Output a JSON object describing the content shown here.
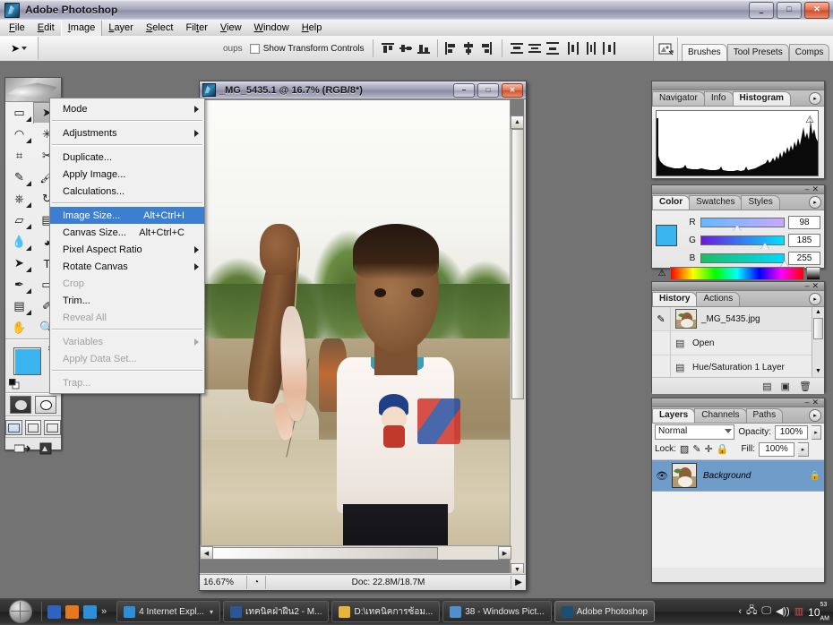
{
  "window": {
    "title": "Adobe Photoshop",
    "minimize": "–",
    "maximize": "□",
    "close": "✕"
  },
  "menubar": {
    "items": [
      {
        "label": "File",
        "accel": "F"
      },
      {
        "label": "Edit",
        "accel": "E"
      },
      {
        "label": "Image",
        "accel": "I"
      },
      {
        "label": "Layer",
        "accel": "L"
      },
      {
        "label": "Select",
        "accel": "S"
      },
      {
        "label": "Filter",
        "accel": "t"
      },
      {
        "label": "View",
        "accel": "V"
      },
      {
        "label": "Window",
        "accel": "W"
      },
      {
        "label": "Help",
        "accel": "H"
      }
    ],
    "active": "Image"
  },
  "image_menu": {
    "items": [
      {
        "label": "Mode",
        "shortcut": "",
        "submenu": true,
        "disabled": false,
        "selected": false
      },
      {
        "sep": true
      },
      {
        "label": "Adjustments",
        "shortcut": "",
        "submenu": true,
        "disabled": false,
        "selected": false
      },
      {
        "sep": true
      },
      {
        "label": "Duplicate...",
        "shortcut": "",
        "submenu": false,
        "disabled": false,
        "selected": false
      },
      {
        "label": "Apply Image...",
        "shortcut": "",
        "submenu": false,
        "disabled": false,
        "selected": false
      },
      {
        "label": "Calculations...",
        "shortcut": "",
        "submenu": false,
        "disabled": false,
        "selected": false
      },
      {
        "sep": true
      },
      {
        "label": "Image Size...",
        "shortcut": "Alt+Ctrl+I",
        "submenu": false,
        "disabled": false,
        "selected": true
      },
      {
        "label": "Canvas Size...",
        "shortcut": "Alt+Ctrl+C",
        "submenu": false,
        "disabled": false,
        "selected": false
      },
      {
        "label": "Pixel Aspect Ratio",
        "shortcut": "",
        "submenu": true,
        "disabled": false,
        "selected": false
      },
      {
        "label": "Rotate Canvas",
        "shortcut": "",
        "submenu": true,
        "disabled": false,
        "selected": false
      },
      {
        "label": "Crop",
        "shortcut": "",
        "submenu": false,
        "disabled": true,
        "selected": false
      },
      {
        "label": "Trim...",
        "shortcut": "",
        "submenu": false,
        "disabled": false,
        "selected": false
      },
      {
        "label": "Reveal All",
        "shortcut": "",
        "submenu": false,
        "disabled": true,
        "selected": false
      },
      {
        "sep": true
      },
      {
        "label": "Variables",
        "shortcut": "",
        "submenu": true,
        "disabled": true,
        "selected": false
      },
      {
        "label": "Apply Data Set...",
        "shortcut": "",
        "submenu": false,
        "disabled": true,
        "selected": false
      },
      {
        "sep": true
      },
      {
        "label": "Trap...",
        "shortcut": "",
        "submenu": false,
        "disabled": true,
        "selected": false
      }
    ]
  },
  "options_bar": {
    "tool_icon": "move-tool",
    "auto_select_groups": "oups",
    "show_transform_label": "Show Transform Controls",
    "show_transform_checked": false
  },
  "palette_well": {
    "tabs": [
      {
        "label": "Brushes",
        "selected": true
      },
      {
        "label": "Tool Presets",
        "selected": false
      },
      {
        "label": "Comps",
        "selected": false
      }
    ]
  },
  "toolbox": {
    "tools": [
      {
        "name": "marquee-tool",
        "glyph": "▭",
        "selected": false,
        "has_flyout": true
      },
      {
        "name": "move-tool",
        "glyph": "➤",
        "selected": true,
        "has_flyout": false
      },
      {
        "name": "lasso-tool",
        "glyph": "◠",
        "selected": false,
        "has_flyout": true
      },
      {
        "name": "magic-wand-tool",
        "glyph": "✳",
        "selected": false,
        "has_flyout": false
      },
      {
        "name": "crop-tool",
        "glyph": "⌗",
        "selected": false,
        "has_flyout": false
      },
      {
        "name": "slice-tool",
        "glyph": "✂",
        "selected": false,
        "has_flyout": true
      },
      {
        "name": "healing-brush-tool",
        "glyph": "✎",
        "selected": false,
        "has_flyout": true
      },
      {
        "name": "brush-tool",
        "glyph": "🖌",
        "selected": false,
        "has_flyout": true
      },
      {
        "name": "clone-stamp-tool",
        "glyph": "⎈",
        "selected": false,
        "has_flyout": true
      },
      {
        "name": "history-brush-tool",
        "glyph": "↻",
        "selected": false,
        "has_flyout": true
      },
      {
        "name": "eraser-tool",
        "glyph": "▱",
        "selected": false,
        "has_flyout": true
      },
      {
        "name": "gradient-tool",
        "glyph": "▤",
        "selected": false,
        "has_flyout": true
      },
      {
        "name": "blur-tool",
        "glyph": "💧",
        "selected": false,
        "has_flyout": true
      },
      {
        "name": "dodge-tool",
        "glyph": "◕",
        "selected": false,
        "has_flyout": true
      },
      {
        "name": "path-selection-tool",
        "glyph": "➤",
        "selected": false,
        "has_flyout": true
      },
      {
        "name": "type-tool",
        "glyph": "T",
        "selected": false,
        "has_flyout": true
      },
      {
        "name": "pen-tool",
        "glyph": "✒",
        "selected": false,
        "has_flyout": true
      },
      {
        "name": "shape-tool",
        "glyph": "▭",
        "selected": false,
        "has_flyout": true
      },
      {
        "name": "notes-tool",
        "glyph": "▤",
        "selected": false,
        "has_flyout": true
      },
      {
        "name": "eyedropper-tool",
        "glyph": "✐",
        "selected": false,
        "has_flyout": true
      },
      {
        "name": "hand-tool",
        "glyph": "✋",
        "selected": false,
        "has_flyout": false
      },
      {
        "name": "zoom-tool",
        "glyph": "🔍",
        "selected": false,
        "has_flyout": false
      }
    ],
    "foreground_color": "#3ab4ef",
    "background_color": "#ffffff",
    "swap_icon": "swap-colors-icon",
    "default_colors_icon": "default-colors-icon"
  },
  "document": {
    "title": "_MG_5435.1 @ 16.7% (RGB/8*)",
    "minimize": "–",
    "maximize": "□",
    "close": "✕",
    "status": {
      "zoom": "16.67%",
      "doc_size": "Doc: 22.8M/18.7M",
      "arrow": "▶"
    }
  },
  "histogram_panel": {
    "tabs": [
      {
        "label": "Navigator",
        "selected": false
      },
      {
        "label": "Info",
        "selected": false
      },
      {
        "label": "Histogram",
        "selected": true
      }
    ],
    "warning_icon": "warning-triangle-icon"
  },
  "color_panel": {
    "tabs": [
      {
        "label": "Color",
        "selected": true
      },
      {
        "label": "Swatches",
        "selected": false
      },
      {
        "label": "Styles",
        "selected": false
      }
    ],
    "channels": [
      {
        "label": "R",
        "value": "98",
        "pos": 38
      },
      {
        "label": "G",
        "value": "185",
        "pos": 72
      },
      {
        "label": "B",
        "value": "255",
        "pos": 96
      }
    ],
    "warning_icon": "gamut-warning-icon"
  },
  "history_panel": {
    "tabs": [
      {
        "label": "History",
        "selected": true
      },
      {
        "label": "Actions",
        "selected": false
      }
    ],
    "rows": [
      {
        "label": "_MG_5435.jpg",
        "type": "snapshot"
      },
      {
        "label": "Open",
        "type": "state"
      },
      {
        "label": "Hue/Saturation 1 Layer",
        "type": "state"
      }
    ],
    "buttons": [
      {
        "name": "new-document-from-state-button",
        "glyph": "▤"
      },
      {
        "name": "new-snapshot-button",
        "glyph": "▣"
      },
      {
        "name": "delete-state-button",
        "glyph": "🗑"
      }
    ]
  },
  "layers_panel": {
    "tabs": [
      {
        "label": "Layers",
        "selected": true
      },
      {
        "label": "Channels",
        "selected": false
      },
      {
        "label": "Paths",
        "selected": false
      }
    ],
    "blend_mode": "Normal",
    "opacity_label": "Opacity:",
    "opacity_value": "100%",
    "lock_label": "Lock:",
    "fill_label": "Fill:",
    "fill_value": "100%",
    "lock_icons": [
      {
        "name": "lock-transparent-pixels-icon",
        "glyph": "▨"
      },
      {
        "name": "lock-image-pixels-icon",
        "glyph": "🖌"
      },
      {
        "name": "lock-position-icon",
        "glyph": "✛"
      },
      {
        "name": "lock-all-icon",
        "glyph": "🔒"
      }
    ],
    "layers": [
      {
        "name": "Background",
        "visible": true,
        "locked": true,
        "selected": true
      }
    ]
  },
  "taskbar": {
    "start_label": "start",
    "quicklaunch": [
      {
        "name": "quicklaunch-notepad-icon",
        "color": "#2f63c0"
      },
      {
        "name": "quicklaunch-firefox-icon",
        "color": "#e8781f"
      },
      {
        "name": "quicklaunch-ie-icon",
        "color": "#2d8fd8"
      }
    ],
    "quicklaunch_more": "»",
    "items": [
      {
        "label": "4 Internet Expl...",
        "icon_color": "#2d8fd8",
        "active": false,
        "group": true
      },
      {
        "label": "เทคนิคฝ่าฝืน2 - M...",
        "icon_color": "#2b579a",
        "active": false,
        "group": false
      },
      {
        "label": "D:\\เทคนิคการซ้อม...",
        "icon_color": "#e8b33a",
        "active": false,
        "group": false
      },
      {
        "label": "38 - Windows Pict...",
        "icon_color": "#4f8fcf",
        "active": false,
        "group": false
      },
      {
        "label": "Adobe Photoshop",
        "icon_color": "#1b4f73",
        "active": true,
        "group": false
      }
    ],
    "tray": {
      "chevron": "‹",
      "icons": [
        {
          "name": "network-icon",
          "glyph": "🖧"
        },
        {
          "name": "display-icon",
          "glyph": "🖵"
        },
        {
          "name": "volume-icon",
          "glyph": "🔊"
        },
        {
          "name": "printer-icon",
          "glyph": "▥"
        }
      ],
      "clock_hour": "10",
      "clock_min": "53",
      "clock_ampm": "AM"
    }
  }
}
